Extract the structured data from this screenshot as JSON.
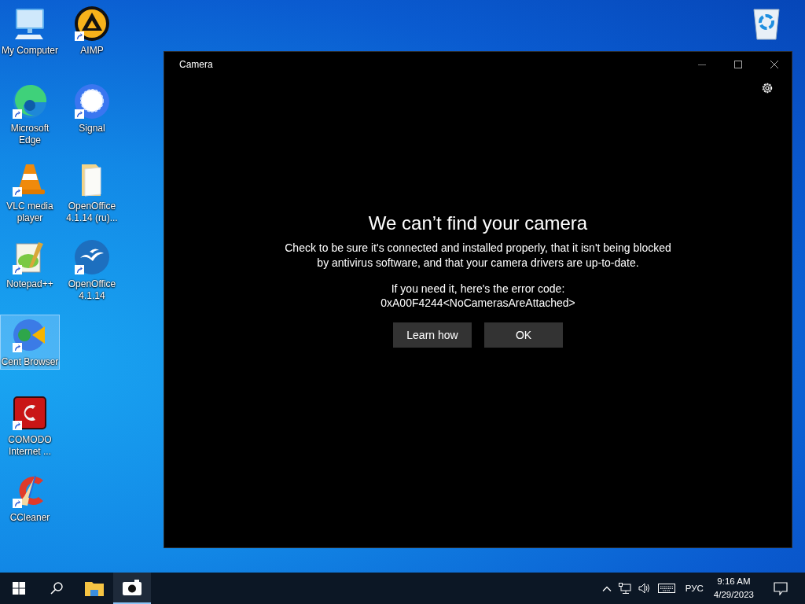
{
  "desktop": {
    "columns": [
      [
        {
          "kind": "computer",
          "label": "My Computer",
          "shortcut": false,
          "selected": false
        },
        {
          "kind": "edge",
          "label": "Microsoft Edge",
          "shortcut": true,
          "selected": false
        },
        {
          "kind": "vlc",
          "label": "VLC media player",
          "shortcut": true,
          "selected": false
        },
        {
          "kind": "notepad",
          "label": "Notepad++",
          "shortcut": true,
          "selected": false
        },
        {
          "kind": "cent",
          "label": "Cent Browser",
          "shortcut": true,
          "selected": true
        },
        {
          "kind": "comodo",
          "label": "COMODO Internet ...",
          "shortcut": true,
          "selected": false
        },
        {
          "kind": "ccleaner",
          "label": "CCleaner",
          "shortcut": true,
          "selected": false
        }
      ],
      [
        {
          "kind": "aimp",
          "label": "AIMP",
          "shortcut": true,
          "selected": false
        },
        {
          "kind": "signal",
          "label": "Signal",
          "shortcut": true,
          "selected": false
        },
        {
          "kind": "folder",
          "label": "OpenOffice 4.1.14 (ru)...",
          "shortcut": false,
          "selected": false
        },
        {
          "kind": "openoffice",
          "label": "OpenOffice 4.1.14",
          "shortcut": true,
          "selected": false
        }
      ]
    ]
  },
  "window": {
    "title": "Camera",
    "heading": "We can’t find your camera",
    "message": "Check to be sure it's connected and installed properly, that it isn't being blocked by antivirus software, and that your camera drivers are up-to-date.",
    "error_intro": "If you need it, here's the error code:",
    "error_code": "0xA00F4244<NoCamerasAreAttached>",
    "buttons": [
      "Learn how",
      "OK"
    ]
  },
  "taskbar": {
    "apps": [
      {
        "kind": "explorer",
        "selected": false
      },
      {
        "kind": "camera",
        "selected": true
      }
    ],
    "language": "РУС",
    "time": "9:16 AM",
    "date": "4/29/2023"
  }
}
